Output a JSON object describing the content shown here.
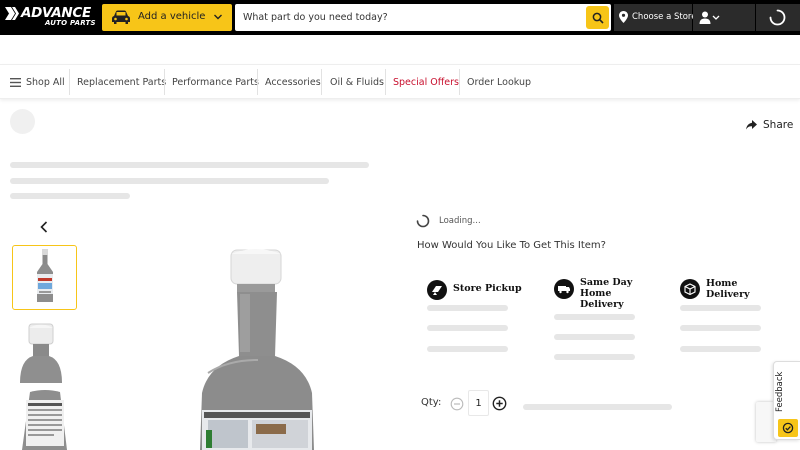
{
  "brand": {
    "logo_line1": "ADVANCE",
    "logo_line2": "AUTO PARTS",
    "accent_color": "#f7c518",
    "offer_color": "#c8102e"
  },
  "header": {
    "vehicle_label": "Add a vehicle",
    "search_placeholder": "What part do you need today?",
    "store_label": "Choose a Store",
    "icons": [
      "car-icon",
      "chevron-down-icon",
      "search-icon",
      "location-pin-icon",
      "account-icon",
      "loading-spinner-icon"
    ]
  },
  "nav": {
    "items": [
      {
        "label": "Shop All"
      },
      {
        "label": "Replacement Parts"
      },
      {
        "label": "Performance Parts"
      },
      {
        "label": "Accessories"
      },
      {
        "label": "Oil & Fluids"
      },
      {
        "label": "Special Offers"
      },
      {
        "label": "Order Lookup"
      }
    ]
  },
  "product": {
    "share_label": "Share",
    "loading_text": "Loading...",
    "fulfillment_title": "How Would You Like To Get This Item?",
    "fulfillment_options": [
      {
        "label": "Store Pickup",
        "icon": "store-pickup-icon"
      },
      {
        "label": "Same Day Home Delivery",
        "icon": "same-day-delivery-icon"
      },
      {
        "label": "Home Delivery",
        "icon": "box-icon"
      }
    ],
    "qty_label": "Qty:",
    "qty_value": "1"
  },
  "widgets": {
    "feedback_label": "Feedback"
  }
}
